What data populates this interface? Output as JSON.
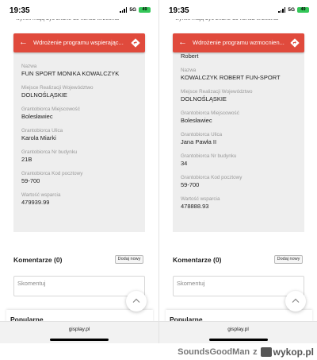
{
  "screens": [
    {
      "status": {
        "time": "19:35",
        "network": "5G",
        "battery": "49"
      },
      "top_text": "wyniki mają być znane do końca września",
      "appbar": {
        "title": "Wdrożenie programu wspierając..."
      },
      "fields": [
        {
          "label": "",
          "value": ""
        },
        {
          "label": "Nazwa",
          "value": "FUN SPORT MONIKA KOWALCZYK"
        },
        {
          "label": "Miejsce Realizacji Województwo",
          "value": "DOLNOŚLĄSKIE"
        },
        {
          "label": "Grantobiorca Miejscowość",
          "value": "Bolesławiec"
        },
        {
          "label": "Grantobiorca Ulica",
          "value": "Karola Miarki"
        },
        {
          "label": "Grantobiorca Nr budynku",
          "value": "21B"
        },
        {
          "label": "Grantobiorca Kod pocztowy",
          "value": "59-700"
        },
        {
          "label": "Wartość wsparcia",
          "value": "479939.99"
        }
      ],
      "comments_label": "Komentarze (0)",
      "add_button": "Dodaj nowy",
      "comment_placeholder": "Skomentuj",
      "popular_label": "Popularne",
      "url": "gisplay.pl"
    },
    {
      "status": {
        "time": "19:35",
        "network": "5G",
        "battery": "49"
      },
      "top_text": "wyniki mają być znane do końca września",
      "appbar": {
        "title": "Wdrożenie programu wzmocnien..."
      },
      "fields": [
        {
          "label": "",
          "value": "Robert"
        },
        {
          "label": "Nazwa",
          "value": "KOWALCZYK ROBERT FUN-SPORT"
        },
        {
          "label": "Miejsce Realizacji Województwo",
          "value": "DOLNOŚLĄSKIE"
        },
        {
          "label": "Grantobiorca Miejscowość",
          "value": "Bolesławiec"
        },
        {
          "label": "Grantobiorca Ulica",
          "value": "Jana Pawła II"
        },
        {
          "label": "Grantobiorca Nr budynku",
          "value": "34"
        },
        {
          "label": "Grantobiorca Kod pocztowy",
          "value": "59-700"
        },
        {
          "label": "Wartość wsparcia",
          "value": "478888.93"
        }
      ],
      "comments_label": "Komentarze (0)",
      "add_button": "Dodaj nowy",
      "comment_placeholder": "Skomentuj",
      "popular_label": "Popularne",
      "url": "gisplay.pl"
    }
  ],
  "watermark": {
    "author": "SoundsGoodMan",
    "separator": "z",
    "site": "wykop.pl"
  },
  "colors": {
    "appbar": "#e04a3c",
    "card": "#eeeeee",
    "battery": "#34c759"
  }
}
